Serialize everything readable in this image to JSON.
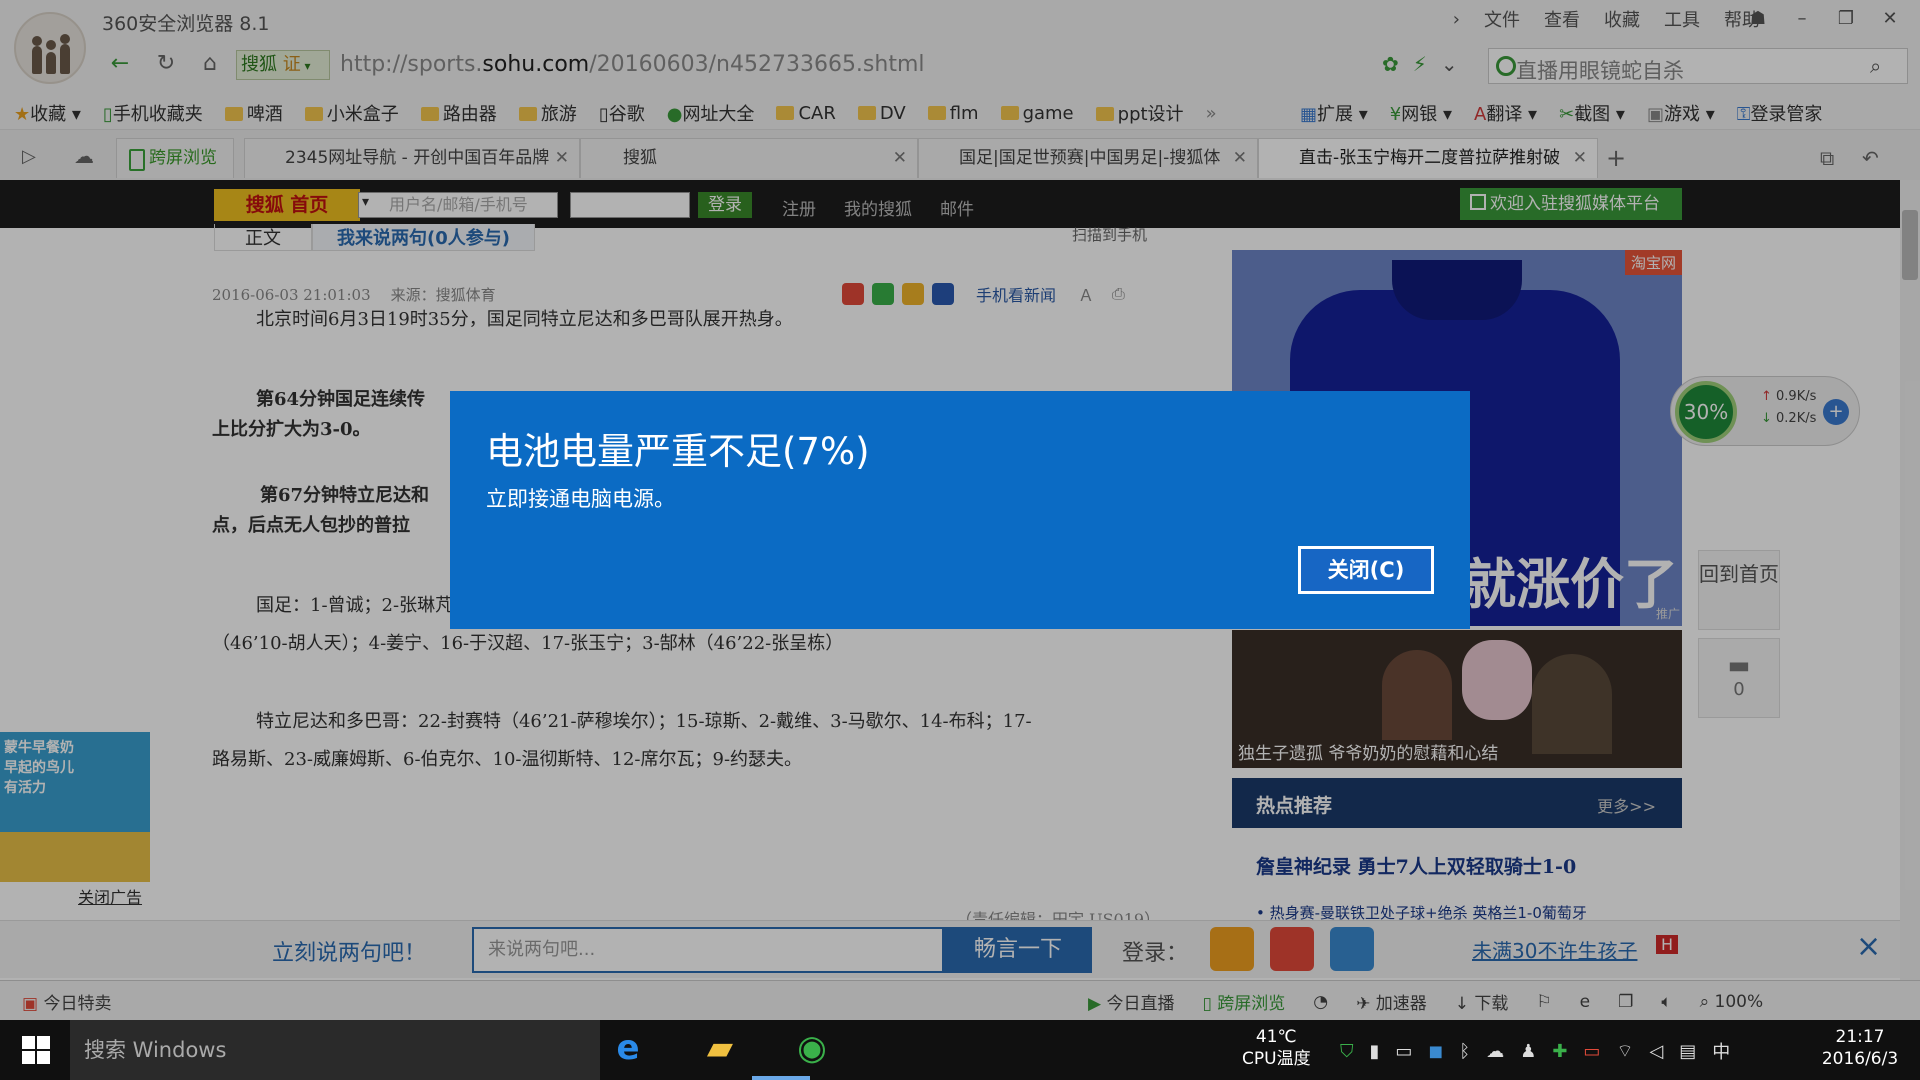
{
  "browser": {
    "title": "360安全浏览器 8.1",
    "menu": [
      "文件",
      "查看",
      "收藏",
      "工具",
      "帮助"
    ],
    "window_controls": [
      "☗",
      "–",
      "❐",
      "✕"
    ],
    "search_engine": "搜狐",
    "search_engine_badge": "证",
    "url_prefix": "http://sports.",
    "url_domain": "sohu.com",
    "url_path": "/20160603/n452733665.shtml",
    "search_placeholder": "直播用眼镜蛇自杀",
    "bookmarks": [
      "收藏",
      "手机收藏夹",
      "啤酒",
      "小米盒子",
      "路由器",
      "旅游",
      "谷歌",
      "网址大全",
      "CAR",
      "DV",
      "flm",
      "game",
      "ppt设计"
    ],
    "toolbar_right": [
      "扩展",
      "网银",
      "翻译",
      "截图",
      "游戏",
      "登录管家"
    ],
    "tabs": [
      {
        "label": "跨屏浏览"
      },
      {
        "label": "2345网址导航 - 开创中国百年品牌"
      },
      {
        "label": "搜狐"
      },
      {
        "label": "国足|国足世预赛|中国男足|-搜狐体"
      },
      {
        "label": "直击-张玉宁梅开二度普拉萨推射破"
      }
    ]
  },
  "sohu_bar": {
    "home": "搜狐 首页",
    "user_placeholder": "用户名/邮箱/手机号",
    "login": "登录",
    "links": [
      "注册",
      "我的搜狐",
      "邮件"
    ],
    "media": "欢迎入驻搜狐媒体平台"
  },
  "article": {
    "tabs": [
      "正文",
      "我来说两句(0人参与)"
    ],
    "scan": "扫描到手机",
    "date": "2016-06-03 21:01:03",
    "source": "来源：搜狐体育",
    "mobile_news": "手机看新闻",
    "paragraphs": [
      "北京时间6月3日19时35分，国足同特立尼达和多巴哥队展开热身。",
      "第64分钟国足连续传",
      "上比分扩大为3-0。",
      "第67分钟特立尼达和",
      "点，后点无人包抄的普拉",
      "国足：1-曾诚；2-张琳芃、15-冯潇霆、7-丁海峰、21-赵明剑（46’6-吴曦）；20-黄博文、13-于海",
      "（46’10-胡人天）；4-姜宁、16-于汉超、17-张玉宁；3-郜林（46’22-张呈栋）",
      "特立尼达和多巴哥：22-封赛特（46’21-萨穆埃尔）；15-琼斯、2-戴维、3-马歇尔、14-布科；17-",
      "路易斯、23-威廉姆斯、6-伯克尔、10-温彻斯特、12-席尔瓦；9-约瑟夫。"
    ],
    "editor": "（责任编辑：田宇 US019）"
  },
  "ads": {
    "taobao": "淘宝网",
    "shirt_text": "就涨价了",
    "promo": "推广",
    "family_caption": "独生子遗孤 爷爷奶奶的慰藉和心结",
    "left_ad_lines": [
      "蒙牛早餐奶",
      "早起的鸟儿",
      "有活力"
    ],
    "left_ad_close": "关闭广告"
  },
  "hot": {
    "title": "热点推荐",
    "more": "更多>>",
    "items": [
      "詹皇神纪录 勇士7人上双轻取骑士1-0",
      "• 热身赛-曼联铁卫处子球+绝杀 英格兰1-0葡萄牙"
    ]
  },
  "side": {
    "back_home": "回到首页",
    "comment_count": "0"
  },
  "net_widget": {
    "percent": "30%",
    "up": "0.9K/s",
    "down": "0.2K/s"
  },
  "comment_bar": {
    "prompt": "立刻说两句吧！",
    "placeholder": "来说两句吧...",
    "submit": "畅言一下",
    "login": "登录：",
    "promo_link": "未满30不许生孩子",
    "promo_badge": "H"
  },
  "status_bar": {
    "today": "今日特卖",
    "items": [
      "今日直播",
      "跨屏浏览",
      "加速器",
      "下载"
    ],
    "zoom": "100%"
  },
  "taskbar": {
    "search": "搜索 Windows",
    "temp": "41℃",
    "temp_label": "CPU温度",
    "ime": "中",
    "time": "21:17",
    "date": "2016/6/3"
  },
  "dialog": {
    "title": "电池电量严重不足(7%)",
    "message": "立即接通电脑电源。",
    "close": "关闭(C)"
  },
  "colors": {
    "dialog_bg": "#0b6bc4",
    "sohu_yellow": "#f0c020",
    "link_blue": "#2a6ab0"
  }
}
